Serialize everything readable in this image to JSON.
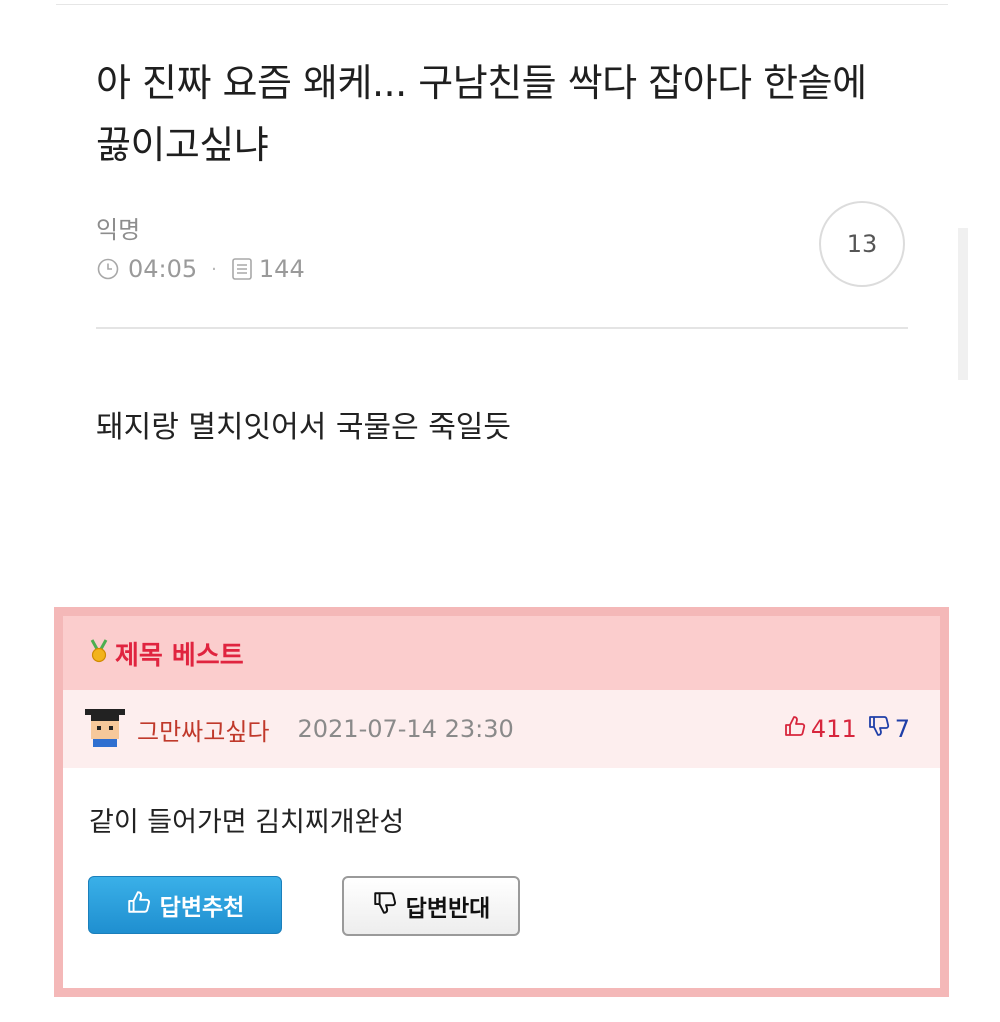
{
  "post": {
    "title": "아 진짜 요즘 왜케... 구남친들 싹다 잡아다 한솥에 끓이고싶냐",
    "author": "익명",
    "time": "04:05",
    "views": "144",
    "comment_count": "13",
    "body": "돼지랑 멸치잇어서 국물은 죽일듯"
  },
  "best": {
    "title": "제목 베스트",
    "reply": {
      "nickname": "그만싸고싶다",
      "datetime": "2021-07-14 23:30",
      "upvotes": "411",
      "downvotes": "7",
      "text": "같이 들어가면 김치찌개완성"
    },
    "recommend_label": "답변추천",
    "oppose_label": "답변반대"
  },
  "colors": {
    "accent_red": "#e0243f",
    "best_border": "#f4b8b8",
    "recommend_blue": "#1f8fd0",
    "downvote_blue": "#1f3fa8"
  },
  "icons": [
    "clock-icon",
    "document-icon",
    "medal-icon",
    "thumbs-up-icon",
    "thumbs-down-icon",
    "avatar"
  ]
}
